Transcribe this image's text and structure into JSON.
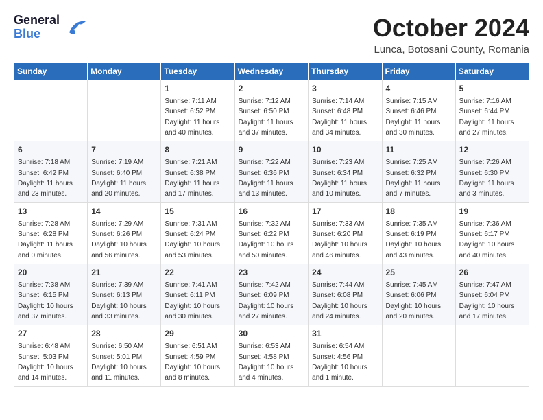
{
  "header": {
    "logo_general": "General",
    "logo_blue": "Blue",
    "month_title": "October 2024",
    "location": "Lunca, Botosani County, Romania"
  },
  "weekdays": [
    "Sunday",
    "Monday",
    "Tuesday",
    "Wednesday",
    "Thursday",
    "Friday",
    "Saturday"
  ],
  "weeks": [
    [
      {
        "day": "",
        "sunrise": "",
        "sunset": "",
        "daylight": ""
      },
      {
        "day": "",
        "sunrise": "",
        "sunset": "",
        "daylight": ""
      },
      {
        "day": "1",
        "sunrise": "Sunrise: 7:11 AM",
        "sunset": "Sunset: 6:52 PM",
        "daylight": "Daylight: 11 hours and 40 minutes."
      },
      {
        "day": "2",
        "sunrise": "Sunrise: 7:12 AM",
        "sunset": "Sunset: 6:50 PM",
        "daylight": "Daylight: 11 hours and 37 minutes."
      },
      {
        "day": "3",
        "sunrise": "Sunrise: 7:14 AM",
        "sunset": "Sunset: 6:48 PM",
        "daylight": "Daylight: 11 hours and 34 minutes."
      },
      {
        "day": "4",
        "sunrise": "Sunrise: 7:15 AM",
        "sunset": "Sunset: 6:46 PM",
        "daylight": "Daylight: 11 hours and 30 minutes."
      },
      {
        "day": "5",
        "sunrise": "Sunrise: 7:16 AM",
        "sunset": "Sunset: 6:44 PM",
        "daylight": "Daylight: 11 hours and 27 minutes."
      }
    ],
    [
      {
        "day": "6",
        "sunrise": "Sunrise: 7:18 AM",
        "sunset": "Sunset: 6:42 PM",
        "daylight": "Daylight: 11 hours and 23 minutes."
      },
      {
        "day": "7",
        "sunrise": "Sunrise: 7:19 AM",
        "sunset": "Sunset: 6:40 PM",
        "daylight": "Daylight: 11 hours and 20 minutes."
      },
      {
        "day": "8",
        "sunrise": "Sunrise: 7:21 AM",
        "sunset": "Sunset: 6:38 PM",
        "daylight": "Daylight: 11 hours and 17 minutes."
      },
      {
        "day": "9",
        "sunrise": "Sunrise: 7:22 AM",
        "sunset": "Sunset: 6:36 PM",
        "daylight": "Daylight: 11 hours and 13 minutes."
      },
      {
        "day": "10",
        "sunrise": "Sunrise: 7:23 AM",
        "sunset": "Sunset: 6:34 PM",
        "daylight": "Daylight: 11 hours and 10 minutes."
      },
      {
        "day": "11",
        "sunrise": "Sunrise: 7:25 AM",
        "sunset": "Sunset: 6:32 PM",
        "daylight": "Daylight: 11 hours and 7 minutes."
      },
      {
        "day": "12",
        "sunrise": "Sunrise: 7:26 AM",
        "sunset": "Sunset: 6:30 PM",
        "daylight": "Daylight: 11 hours and 3 minutes."
      }
    ],
    [
      {
        "day": "13",
        "sunrise": "Sunrise: 7:28 AM",
        "sunset": "Sunset: 6:28 PM",
        "daylight": "Daylight: 11 hours and 0 minutes."
      },
      {
        "day": "14",
        "sunrise": "Sunrise: 7:29 AM",
        "sunset": "Sunset: 6:26 PM",
        "daylight": "Daylight: 10 hours and 56 minutes."
      },
      {
        "day": "15",
        "sunrise": "Sunrise: 7:31 AM",
        "sunset": "Sunset: 6:24 PM",
        "daylight": "Daylight: 10 hours and 53 minutes."
      },
      {
        "day": "16",
        "sunrise": "Sunrise: 7:32 AM",
        "sunset": "Sunset: 6:22 PM",
        "daylight": "Daylight: 10 hours and 50 minutes."
      },
      {
        "day": "17",
        "sunrise": "Sunrise: 7:33 AM",
        "sunset": "Sunset: 6:20 PM",
        "daylight": "Daylight: 10 hours and 46 minutes."
      },
      {
        "day": "18",
        "sunrise": "Sunrise: 7:35 AM",
        "sunset": "Sunset: 6:19 PM",
        "daylight": "Daylight: 10 hours and 43 minutes."
      },
      {
        "day": "19",
        "sunrise": "Sunrise: 7:36 AM",
        "sunset": "Sunset: 6:17 PM",
        "daylight": "Daylight: 10 hours and 40 minutes."
      }
    ],
    [
      {
        "day": "20",
        "sunrise": "Sunrise: 7:38 AM",
        "sunset": "Sunset: 6:15 PM",
        "daylight": "Daylight: 10 hours and 37 minutes."
      },
      {
        "day": "21",
        "sunrise": "Sunrise: 7:39 AM",
        "sunset": "Sunset: 6:13 PM",
        "daylight": "Daylight: 10 hours and 33 minutes."
      },
      {
        "day": "22",
        "sunrise": "Sunrise: 7:41 AM",
        "sunset": "Sunset: 6:11 PM",
        "daylight": "Daylight: 10 hours and 30 minutes."
      },
      {
        "day": "23",
        "sunrise": "Sunrise: 7:42 AM",
        "sunset": "Sunset: 6:09 PM",
        "daylight": "Daylight: 10 hours and 27 minutes."
      },
      {
        "day": "24",
        "sunrise": "Sunrise: 7:44 AM",
        "sunset": "Sunset: 6:08 PM",
        "daylight": "Daylight: 10 hours and 24 minutes."
      },
      {
        "day": "25",
        "sunrise": "Sunrise: 7:45 AM",
        "sunset": "Sunset: 6:06 PM",
        "daylight": "Daylight: 10 hours and 20 minutes."
      },
      {
        "day": "26",
        "sunrise": "Sunrise: 7:47 AM",
        "sunset": "Sunset: 6:04 PM",
        "daylight": "Daylight: 10 hours and 17 minutes."
      }
    ],
    [
      {
        "day": "27",
        "sunrise": "Sunrise: 6:48 AM",
        "sunset": "Sunset: 5:03 PM",
        "daylight": "Daylight: 10 hours and 14 minutes."
      },
      {
        "day": "28",
        "sunrise": "Sunrise: 6:50 AM",
        "sunset": "Sunset: 5:01 PM",
        "daylight": "Daylight: 10 hours and 11 minutes."
      },
      {
        "day": "29",
        "sunrise": "Sunrise: 6:51 AM",
        "sunset": "Sunset: 4:59 PM",
        "daylight": "Daylight: 10 hours and 8 minutes."
      },
      {
        "day": "30",
        "sunrise": "Sunrise: 6:53 AM",
        "sunset": "Sunset: 4:58 PM",
        "daylight": "Daylight: 10 hours and 4 minutes."
      },
      {
        "day": "31",
        "sunrise": "Sunrise: 6:54 AM",
        "sunset": "Sunset: 4:56 PM",
        "daylight": "Daylight: 10 hours and 1 minute."
      },
      {
        "day": "",
        "sunrise": "",
        "sunset": "",
        "daylight": ""
      },
      {
        "day": "",
        "sunrise": "",
        "sunset": "",
        "daylight": ""
      }
    ]
  ]
}
